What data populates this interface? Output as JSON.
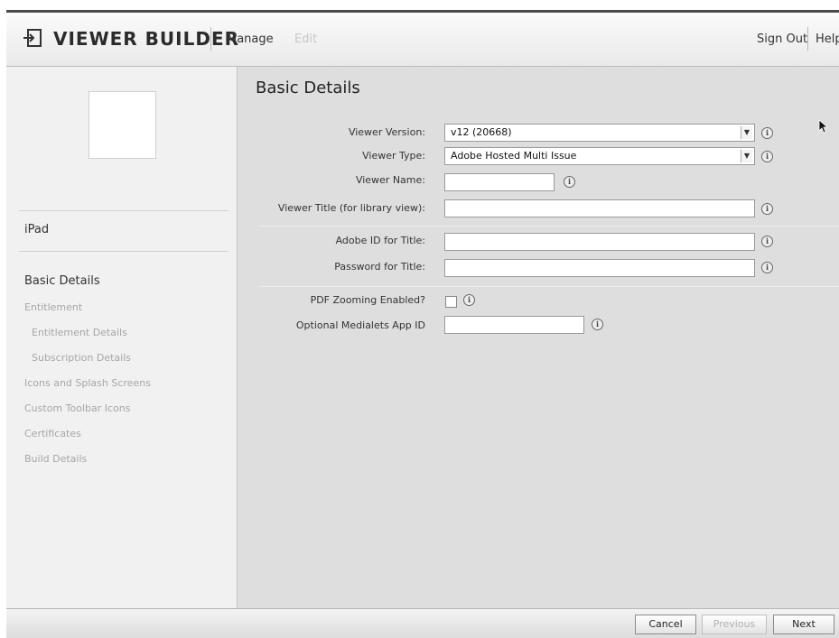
{
  "header": {
    "title": "VIEWER BUILDER",
    "logo_icon": "viewer-builder-logo-icon",
    "nav": {
      "manage": "Manage",
      "edit": "Edit"
    },
    "sign_out": "Sign Out",
    "help": "Help"
  },
  "sidebar": {
    "device": "iPad",
    "items": [
      {
        "label": "Basic Details",
        "active": true
      },
      {
        "label": "Entitlement",
        "active": false
      },
      {
        "label": "Entitlement Details",
        "active": false,
        "sub": true
      },
      {
        "label": "Subscription Details",
        "active": false,
        "sub": true
      },
      {
        "label": "Icons and Splash Screens",
        "active": false
      },
      {
        "label": "Custom Toolbar Icons",
        "active": false
      },
      {
        "label": "Certificates",
        "active": false
      },
      {
        "label": "Build Details",
        "active": false
      }
    ]
  },
  "main": {
    "title": "Basic Details",
    "viewer_version": {
      "label": "Viewer Version:",
      "value": "v12 (20668)"
    },
    "viewer_type": {
      "label": "Viewer Type:",
      "value": "Adobe Hosted Multi Issue"
    },
    "viewer_name": {
      "label": "Viewer Name:",
      "value": ""
    },
    "viewer_title": {
      "label": "Viewer Title (for library view):",
      "value": ""
    },
    "adobe_id": {
      "label": "Adobe ID for Title:",
      "value": ""
    },
    "password": {
      "label": "Password for Title:",
      "value": ""
    },
    "pdf_zooming": {
      "label": "PDF Zooming Enabled?",
      "checked": false
    },
    "medialets": {
      "label": "Optional Medialets App ID",
      "value": ""
    },
    "info_icon": "info-icon"
  },
  "footer": {
    "cancel": "Cancel",
    "previous": "Previous",
    "next": "Next"
  },
  "colors": {
    "content_bg": "#dedede",
    "sidebar_bg": "#f1f1f1",
    "disabled_text": "#a6a6a6"
  }
}
